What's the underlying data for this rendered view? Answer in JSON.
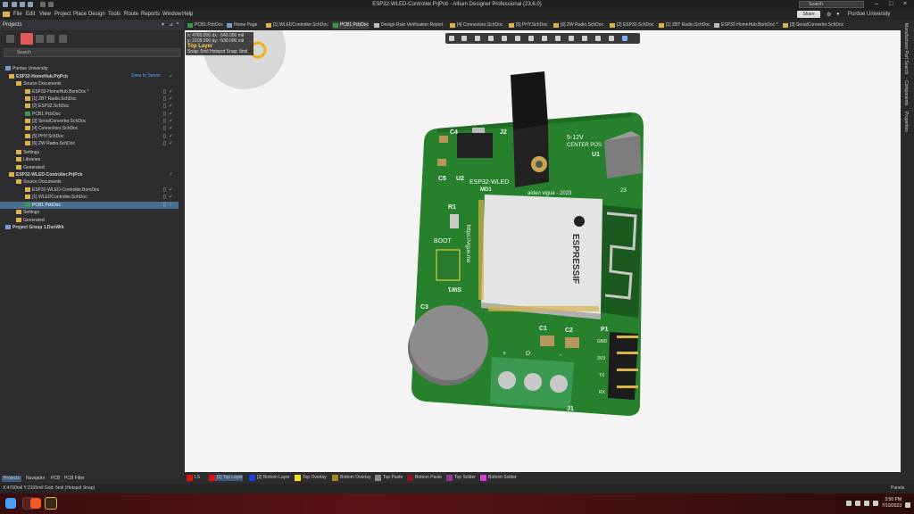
{
  "window": {
    "title": "ESP32-WLED-Controller.PrjPcb - Altium Designer Professional (23.6.0)"
  },
  "menubar": {
    "items": [
      "File",
      "Edit",
      "View",
      "Project",
      "Place",
      "Design",
      "Tools",
      "Route",
      "Reports",
      "Window",
      "Help"
    ],
    "search_placeholder": "Search",
    "share_label": "Share",
    "user": "Purdue University"
  },
  "projects_panel": {
    "title": "Projects",
    "search_placeholder": "Search",
    "save_to_server": "Save to Server",
    "tree": [
      {
        "label": "Purdue University",
        "level": 0,
        "bold": false
      },
      {
        "label": "ESP32-HomeHub.PrjPcb",
        "level": 1,
        "bold": true
      },
      {
        "label": "Source Documents",
        "level": 2,
        "bold": false
      },
      {
        "label": "ESP32-HomeHub.BomDoc *",
        "level": 3,
        "bold": false
      },
      {
        "label": "[1] ZBT Radio.SchDoc",
        "level": 3,
        "bold": false
      },
      {
        "label": "[2] ESP32.SchDoc",
        "level": 3,
        "bold": false
      },
      {
        "label": "PCB1.PcbDoc",
        "level": 3,
        "bold": false
      },
      {
        "label": "[3] SerialConverter.SchDoc",
        "level": 3,
        "bold": false
      },
      {
        "label": "[4] Connectors.SchDoc",
        "level": 3,
        "bold": false
      },
      {
        "label": "[5] PHY.SchDoc",
        "level": 3,
        "bold": false
      },
      {
        "label": "[6] ZW Radio.SchDoc",
        "level": 3,
        "bold": false
      },
      {
        "label": "Settings",
        "level": 2,
        "bold": false
      },
      {
        "label": "Libraries",
        "level": 2,
        "bold": false
      },
      {
        "label": "Generated",
        "level": 2,
        "bold": false
      },
      {
        "label": "ESP32-WLED-Controller.PrjPcb",
        "level": 1,
        "bold": true
      },
      {
        "label": "Source Documents",
        "level": 2,
        "bold": false
      },
      {
        "label": "ESP32-WLED-Controller.BomDoc",
        "level": 3,
        "bold": false
      },
      {
        "label": "[1] WLEDController.SchDoc",
        "level": 3,
        "bold": false
      },
      {
        "label": "PCB1.PcbDoc",
        "level": 3,
        "bold": false,
        "selected": true
      },
      {
        "label": "Settings",
        "level": 2,
        "bold": false
      },
      {
        "label": "Generated",
        "level": 2,
        "bold": false
      },
      {
        "label": "Project Group 1.DsnWrk",
        "level": 0,
        "bold": true
      }
    ],
    "bottom_tabs": [
      "Projects",
      "Navigator",
      "PCB",
      "PCB Filter"
    ]
  },
  "doc_tabs": [
    "PCB1.PcbDoc",
    "Home Page",
    "[1] WLEDController.SchDoc",
    "PCB1.PcbDoc",
    "Design Rule Verification Report",
    "[4] Connectors.SchDoc",
    "[5] PHY.SchDoc",
    "[6] ZW Radio.SchDoc",
    "[2] ESP32.SchDoc",
    "[1] ZBT Radio.SchDoc",
    "ESP32-HomeHub.BomDoc *",
    "[3] SerialConverter.SchDoc"
  ],
  "hud": {
    "x_line": "x: 4760.000   dx: -540.000 mil",
    "y_line": "y: 2105.000   dy: -530.000 mil",
    "layer": "Top Layer",
    "snap": "Snap: 5mil Hotspot Snap: 8mil"
  },
  "right_panels": [
    "Manufacturer Part Search",
    "Components",
    "Properties"
  ],
  "pcb_labels": {
    "j2": "J2",
    "c4": "C4",
    "c5": "C5",
    "u2": "U2",
    "u1": "U1",
    "md1": "MD1",
    "board_name": "ESP32-WLED",
    "author": "aiden vigue - 2023",
    "power": "5-12V",
    "center": "CENTER POS",
    "r1": "R1",
    "boot": "BOOT",
    "url": "https://vigue.me",
    "sw": "SW1",
    "brand": "ESPRESSIF",
    "c1": "C1",
    "c2": "C2",
    "p1": "P1",
    "j1": "J1",
    "d": "D",
    "plus": "+",
    "minus": "-",
    "pins": [
      "GND",
      "3V3",
      "TX",
      "RX"
    ],
    "c3": "C3",
    "twenty_three": "23"
  },
  "layers": [
    {
      "label": "LS",
      "color": "#e01010"
    },
    {
      "label": "[1] Top Layer",
      "color": "#e01010",
      "active": true
    },
    {
      "label": "[2] Bottom Layer",
      "color": "#1c3ee0"
    },
    {
      "label": "Top Overlay",
      "color": "#f2e21a"
    },
    {
      "label": "Bottom Overlay",
      "color": "#9a8a20"
    },
    {
      "label": "Top Paste",
      "color": "#8a8a8a"
    },
    {
      "label": "Bottom Paste",
      "color": "#8a1a1a"
    },
    {
      "label": "Top Solder",
      "color": "#8a3a8a"
    },
    {
      "label": "Bottom Solder",
      "color": "#d040d0"
    }
  ],
  "status": {
    "text": "X:4760mil Y:2105mil   Grid: 5mil     (Hotspot Snap)",
    "panels_label": "Panels"
  },
  "taskbar": {
    "time": "3:50 PM",
    "date": "7/10/2023"
  }
}
